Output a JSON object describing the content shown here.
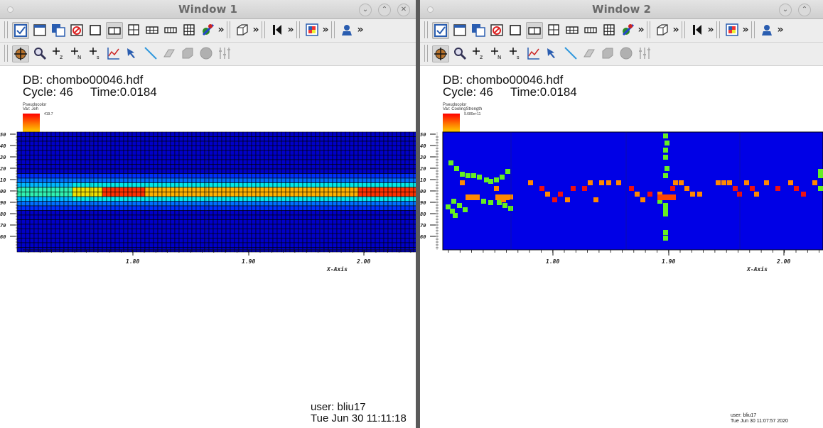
{
  "windows": [
    {
      "title": "Window 1",
      "db": "DB: chombo00046.hdf",
      "cycle": "Cycle: 46",
      "time": "Time:0.0184",
      "legend_type": "Pseudocolor",
      "legend_var": "Var: Jeh",
      "legend_max": "419.7",
      "x_axis_label": "X-Axis",
      "y_ticks": [
        "50",
        "40",
        "30",
        "20",
        "10",
        "00",
        "90",
        "80",
        "70",
        "60"
      ],
      "x_ticks": [
        "1.80",
        "1.90",
        "2.00"
      ],
      "user": "user: bliu17",
      "date": "Tue Jun 30 11:11:18"
    },
    {
      "title": "Window 2",
      "db": "DB: chombo00046.hdf",
      "cycle": "Cycle: 46",
      "time": "Time:0.0184",
      "legend_type": "Pseudocolor",
      "legend_var": "Var: CoolingStrength",
      "legend_max": "9.680e+11",
      "x_axis_label": "X-Axis",
      "y_ticks": [
        "50",
        "40",
        "30",
        "20",
        "10",
        "00",
        "90",
        "80",
        "70",
        "60"
      ],
      "x_ticks": [
        "1.80",
        "1.90",
        "2.00"
      ],
      "user": "user: bliu17",
      "date": "Tue Jun 30 11:07:57 2020"
    }
  ],
  "toolbar_icons_row1": [
    "draw-plots-icon",
    "new-window-icon",
    "copy-window-icon",
    "clear-window-icon",
    "layout-1x1-icon",
    "layout-1x2-icon",
    "layout-2x2-icon",
    "layout-3x2-icon",
    "layout-2x3-icon",
    "layout-3x3-icon",
    "lock-view-icon",
    "more-icon",
    "view-3d-icon",
    "more-icon",
    "animation-step-back-icon",
    "more-icon",
    "palette-icon",
    "more-icon",
    "save-icon",
    "more-icon"
  ],
  "toolbar_icons_row2": [
    "navigate-icon",
    "zoom-icon",
    "zone-pick-icon",
    "node-pick-icon",
    "spreadsheet-pick-icon",
    "lineout-icon",
    "pick-arrow-icon",
    "line-tool-icon",
    "plane-tool-icon",
    "box-tool-icon",
    "sphere-tool-icon",
    "point-tool-icon"
  ],
  "colors": {
    "plot_background": "#0000e6",
    "hot": "#ff4400",
    "accent_green": "#66ee22"
  }
}
